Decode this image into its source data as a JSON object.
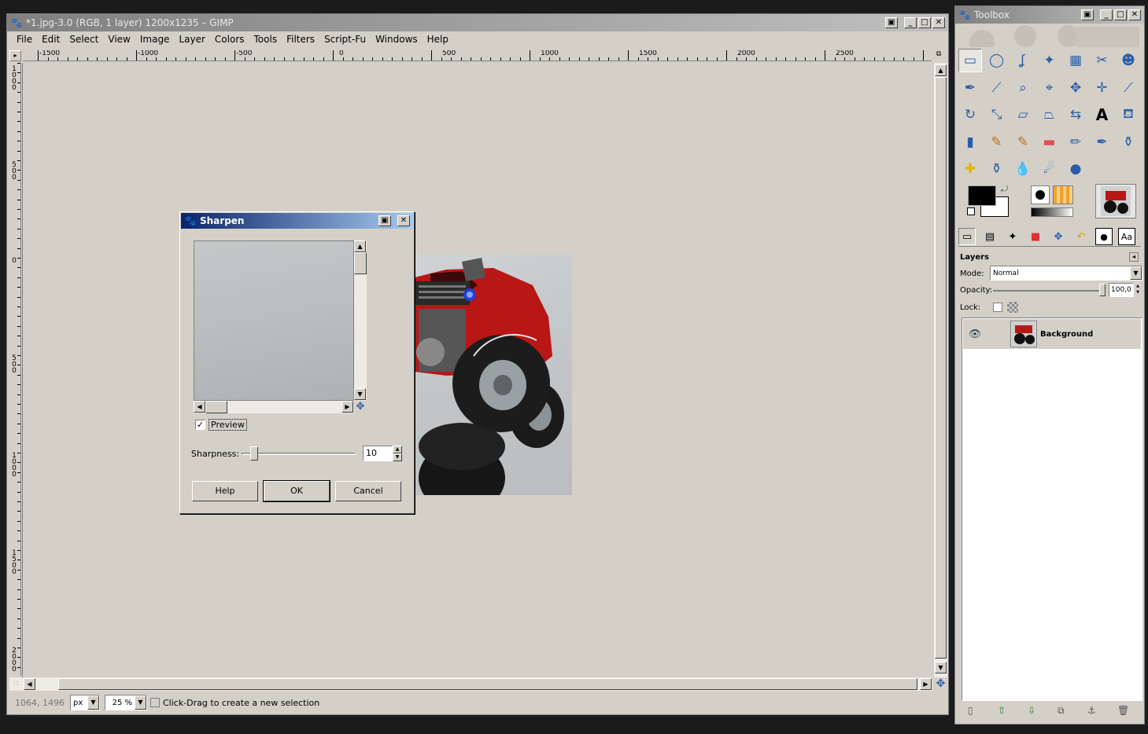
{
  "main_window": {
    "title": "*1.jpg-3.0 (RGB, 1 layer) 1200x1235 – GIMP",
    "controls": {
      "restore": "▣",
      "minimize": "_",
      "maximize": "□",
      "close": "✕"
    }
  },
  "menubar": [
    "File",
    "Edit",
    "Select",
    "View",
    "Image",
    "Layer",
    "Colors",
    "Tools",
    "Filters",
    "Script-Fu",
    "Windows",
    "Help"
  ],
  "rulers": {
    "horizontal": [
      "-1500",
      "-1000",
      "-500",
      "0",
      "500",
      "1000",
      "1500",
      "2000",
      "2500"
    ],
    "vertical": [
      "1000",
      "500",
      "0",
      "500",
      "1000",
      "1500",
      "2000"
    ]
  },
  "statusbar": {
    "coords": "1064, 1496",
    "unit": "px",
    "zoom": "25 %",
    "message": "Click-Drag to create a new selection"
  },
  "sharpen_dialog": {
    "title": "Sharpen",
    "preview_label": "Preview",
    "preview_checked": true,
    "sharpness_label": "Sharpness:",
    "sharpness_value": "10",
    "help_label": "Help",
    "ok_label": "OK",
    "cancel_label": "Cancel"
  },
  "toolbox": {
    "title": "Toolbox",
    "tools": [
      [
        "rect-select-icon",
        "ellipse-select-icon",
        "free-select-icon",
        "fuzzy-select-icon",
        "color-select-icon",
        "scissors-icon",
        "foreground-select-icon"
      ],
      [
        "paths-icon",
        "color-picker-icon",
        "zoom-icon",
        "measure-icon",
        "move-icon",
        "align-icon",
        "crop-icon"
      ],
      [
        "rotate-icon",
        "scale-icon",
        "shear-icon",
        "perspective-icon",
        "flip-icon",
        "text-icon",
        "bucket-fill-icon"
      ],
      [
        "blend-icon",
        "pencil-icon",
        "paintbrush-icon",
        "eraser-icon",
        "airbrush-icon",
        "ink-icon",
        "clone-icon"
      ],
      [
        "heal-icon",
        "perspective-clone-icon",
        "blur-icon",
        "smudge-icon",
        "dodge-burn-icon"
      ]
    ],
    "tool_glyphs": [
      [
        "▭",
        "◯",
        "ʆ",
        "✦",
        "▦",
        "✂",
        "☻"
      ],
      [
        "✒",
        "⟋",
        "⌕",
        "⌖",
        "✥",
        "✛",
        "⟋"
      ],
      [
        "↻",
        "⤡",
        "▱",
        "⏢",
        "⇆",
        "A",
        "⛾"
      ],
      [
        "▮",
        "✎",
        "✎",
        "▬",
        "✏",
        "✒",
        "⚱"
      ],
      [
        "✚",
        "⚱",
        "💧",
        "☄",
        "●"
      ]
    ],
    "dock_tab_icons": [
      "layers-tab-icon",
      "channels-tab-icon",
      "paths-tab-icon",
      "colormap-tab-icon",
      "histogram-tab-icon",
      "undo-tab-icon",
      "brushes-tab-icon",
      "fonts-tab-icon"
    ],
    "dock_tab_glyphs": [
      "▭",
      "▤",
      "✦",
      "■",
      "✥",
      "↶",
      "●",
      "Aa"
    ],
    "layers": {
      "title": "Layers",
      "mode_label": "Mode:",
      "mode_value": "Normal",
      "opacity_label": "Opacity:",
      "opacity_value": "100,0",
      "lock_label": "Lock:",
      "items": [
        {
          "name": "Background",
          "visible": true
        }
      ]
    },
    "bottom_icons": [
      "new-layer-icon",
      "raise-layer-icon",
      "lower-layer-icon",
      "duplicate-layer-icon",
      "anchor-layer-icon",
      "delete-layer-icon"
    ],
    "bottom_glyphs": [
      "▯",
      "⇧",
      "⇩",
      "⧉",
      "⚓",
      "🗑"
    ]
  },
  "colors": {
    "accent": "#0a246a",
    "window_bg": "#d4d0c8",
    "truck_red": "#c11a1a"
  }
}
